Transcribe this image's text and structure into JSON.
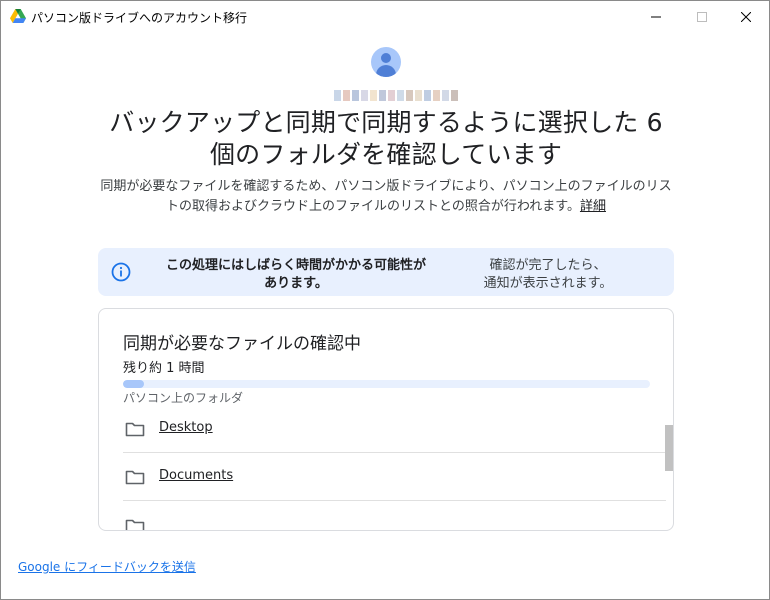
{
  "window": {
    "title": "パソコン版ドライブへのアカウント移行",
    "icon": "google-drive-icon"
  },
  "header": {
    "avatar_icon": "account-avatar-icon",
    "heading_line1": "バックアップと同期で同期するように選択した 6",
    "heading_line2": "個のフォルダを確認しています",
    "description": "同期が必要なファイルを確認するため、パソコン版ドライブにより、パソコン上のファイルのリストの取得およびクラウド上のファイルのリストとの照合が行われます。",
    "details_link": "詳細"
  },
  "info_banner": {
    "icon": "info-icon",
    "bold_line1": "この処理にはしばらく時間がかかる可能性が",
    "bold_line2": "あります。",
    "note_line1": "確認が完了したら、",
    "note_line2": "通知が表示されます。"
  },
  "card": {
    "title": "同期が必要なファイルの確認中",
    "time_remaining": "残り約 1 時間",
    "progress_fraction": 0.04,
    "section_label": "パソコン上のフォルダ",
    "folders": [
      {
        "name": "Desktop"
      },
      {
        "name": "Documents"
      }
    ]
  },
  "footer": {
    "feedback_link": "Google にフィードバックを送信"
  },
  "colors": {
    "accent": "#1a73e8",
    "banner_bg": "#e8f0fe",
    "progress_fill": "#a8c7fa",
    "avatar": "#4f7fd6"
  }
}
